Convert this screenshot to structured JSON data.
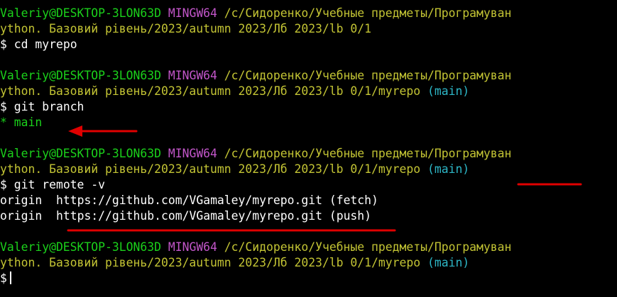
{
  "colors": {
    "background": "#000000",
    "user_host": "#1bd11b",
    "shell": "#c256c9",
    "path": "#c3c434",
    "branch": "#2db7c7",
    "annotation": "#e00000"
  },
  "prompt": {
    "user_host": "Valeriy@DESKTOP-3LON63D",
    "shell": "MINGW64",
    "path_line1": "/c/Сидоренко/Учебные предметы/Програмуван",
    "path_line2_base": "ython. Базовий рівень/2023/autumn 2023/Лб 2023/lb 0/1",
    "path_line2_repo": "ython. Базовий рівень/2023/autumn 2023/Лб 2023/lb 0/1/myrepo",
    "branch": "(main)",
    "symbol": "$"
  },
  "commands": {
    "cd": "cd myrepo",
    "branch": "git branch",
    "remote": "git remote -v"
  },
  "output": {
    "branch_current": "* main",
    "remote_fetch_name": "origin",
    "remote_fetch_url": "https://github.com/VGamaley/myrepo.git",
    "remote_fetch_type": "(fetch)",
    "remote_push_name": "origin",
    "remote_push_url": "https://github.com/VGamaley/myrepo.git",
    "remote_push_type": "(push)"
  },
  "annotations": [
    "arrow-to-main-branch",
    "underline-main-branch-label",
    "underline-push-url"
  ]
}
